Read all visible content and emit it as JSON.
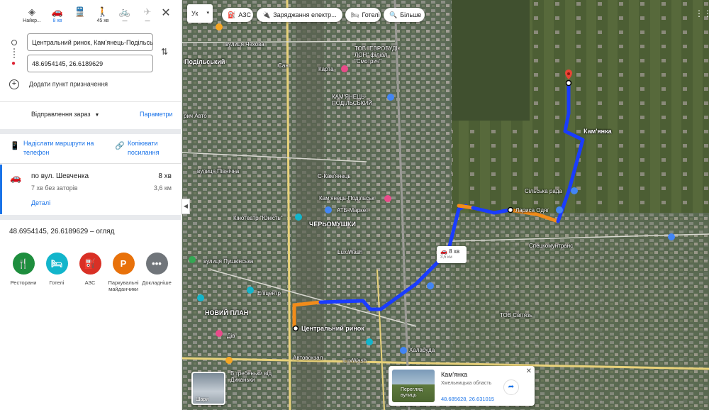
{
  "modes": [
    {
      "icon": "◈",
      "label": "Найкр...",
      "name": "mode-best",
      "state": "normal"
    },
    {
      "icon": "🚗",
      "label": "8 хв",
      "name": "mode-driving",
      "state": "active"
    },
    {
      "icon": "🚆",
      "label": "",
      "name": "mode-transit",
      "state": "normal"
    },
    {
      "icon": "🚶",
      "label": "45 хв",
      "name": "mode-walking",
      "state": "normal"
    },
    {
      "icon": "🚲",
      "label": "—",
      "name": "mode-cycling",
      "state": "disabled"
    },
    {
      "icon": "✈",
      "label": "—",
      "name": "mode-flight",
      "state": "disabled"
    }
  ],
  "close": "✕",
  "origin": {
    "value": "Центральний ринок, Кам'янець-Подільський"
  },
  "destination": {
    "value": "48.6954145, 26.6189629"
  },
  "swap": "⇅",
  "add_destination": "Додати пункт призначення",
  "depart": {
    "label": "Відправлення зараз",
    "caret": "▼"
  },
  "params": "Параметри",
  "share_phone": {
    "icon": "📱",
    "label": "Надіслати маршрути на телефон"
  },
  "copy_link": {
    "icon": "🔗",
    "label": "Копіювати посилання"
  },
  "route": {
    "icon": "🚗",
    "name": "по вул. Шевченка",
    "time": "8 хв",
    "traffic": "7 хв без заторів",
    "distance": "3,6 км",
    "details": "Деталі"
  },
  "overview": "48.6954145, 26.6189629 – огляд",
  "pois": [
    {
      "label": "Ресторани",
      "glyph": "🍴",
      "color": "#1e8e3e",
      "name": "poi-restaurants"
    },
    {
      "label": "Готелі",
      "glyph": "🛏",
      "color": "#12b5cb",
      "name": "poi-hotels"
    },
    {
      "label": "АЗС",
      "glyph": "⛽",
      "color": "#d93025",
      "name": "poi-gas"
    },
    {
      "label": "Паркувальні майданчики",
      "glyph": "P",
      "color": "#e8710a",
      "name": "poi-parking"
    },
    {
      "label": "Докладніше",
      "glyph": "•••",
      "color": "#70757a",
      "name": "poi-more"
    }
  ],
  "collapse": "◀",
  "lang": {
    "label": "Ук",
    "caret": "▾"
  },
  "chips": [
    {
      "icon": "⛽",
      "label": "АЗС",
      "name": "chip-gas"
    },
    {
      "icon": "🔌",
      "label": "Заряджання електр...",
      "name": "chip-charging"
    },
    {
      "icon": "🛏",
      "label": "Готелі",
      "name": "chip-hotels"
    },
    {
      "icon": "🔍",
      "label": "Більше",
      "name": "chip-more"
    }
  ],
  "apps": "⋮⋮⋮",
  "map_labels": [
    {
      "text": "вулиця Чехова",
      "name": "label-chekhova"
    },
    {
      "text": "ТОВ \"ЕВРОБУДІ-ЛОН\" філіал \"Смотрич\"",
      "name": "label-evrobud"
    },
    {
      "text": "КАМ'ЯНЕЦЬ-ПОДІЛЬСЬКИЙ",
      "name": "label-kp-station"
    },
    {
      "text": "Подільський",
      "name": "label-podilskyi"
    },
    {
      "text": "Сан",
      "name": "label-san"
    },
    {
      "text": "Карта",
      "name": "label-karta"
    },
    {
      "text": "рич Авто",
      "name": "label-rich-avto"
    },
    {
      "text": "Кам'янка",
      "name": "label-kamianka"
    },
    {
      "text": "вулиця Північна",
      "name": "label-pivnichna"
    },
    {
      "text": "С-Кам'янець",
      "name": "label-s-kamianets"
    },
    {
      "text": "Кам'янець-Подільськ",
      "name": "label-kp-city"
    },
    {
      "text": "Сільська рада",
      "name": "label-silska-rada"
    },
    {
      "text": "Лариса Одяг",
      "name": "label-larysa"
    },
    {
      "text": "АТБ-Маркет",
      "name": "label-atb"
    },
    {
      "text": "Кінотеатр \"Юність\"",
      "name": "label-cinema"
    },
    {
      "text": "ЧЕРЬОМУШКИ",
      "name": "label-cheremushky"
    },
    {
      "text": "Спецкомунтранс",
      "name": "label-spetskom"
    },
    {
      "text": "Lux.Wash",
      "name": "label-luxwash"
    },
    {
      "text": "вулиця Пушкінська",
      "name": "label-pushkinska"
    },
    {
      "text": "Епіцентр",
      "name": "label-epicentr"
    },
    {
      "text": "НОВИЙ ПЛАН",
      "name": "label-novyi-plan"
    },
    {
      "text": "ТОВ Світязь",
      "name": "label-svitiaz"
    },
    {
      "text": "Центральний ринок",
      "name": "label-central-market"
    },
    {
      "text": "Автовокзал",
      "name": "label-avtovokzal"
    },
    {
      "text": "LuxWash",
      "name": "label-luxwash2"
    },
    {
      "text": "Халабуда",
      "name": "label-khalabuda"
    },
    {
      "text": "Вітребеньки від Диканьки",
      "name": "label-vitrebenky"
    },
    {
      "text": "Дів",
      "name": "label-div"
    },
    {
      "text": "Пам'ятник",
      "name": "label-pamiatnyk"
    }
  ],
  "route_box": {
    "time": "8 хв",
    "distance": "3,5 км"
  },
  "street_view": {
    "label": "Шари"
  },
  "card": {
    "name": "Кам'янка",
    "region": "Хмельницька область",
    "coords": "48.685628, 26.631015",
    "thumb_label": "Перегляд вулиць",
    "close": "✕",
    "share": "➦"
  },
  "colors": {
    "route_blue": "#1a3cff",
    "route_orange": "#f28c1a",
    "accent": "#1a73e8"
  }
}
